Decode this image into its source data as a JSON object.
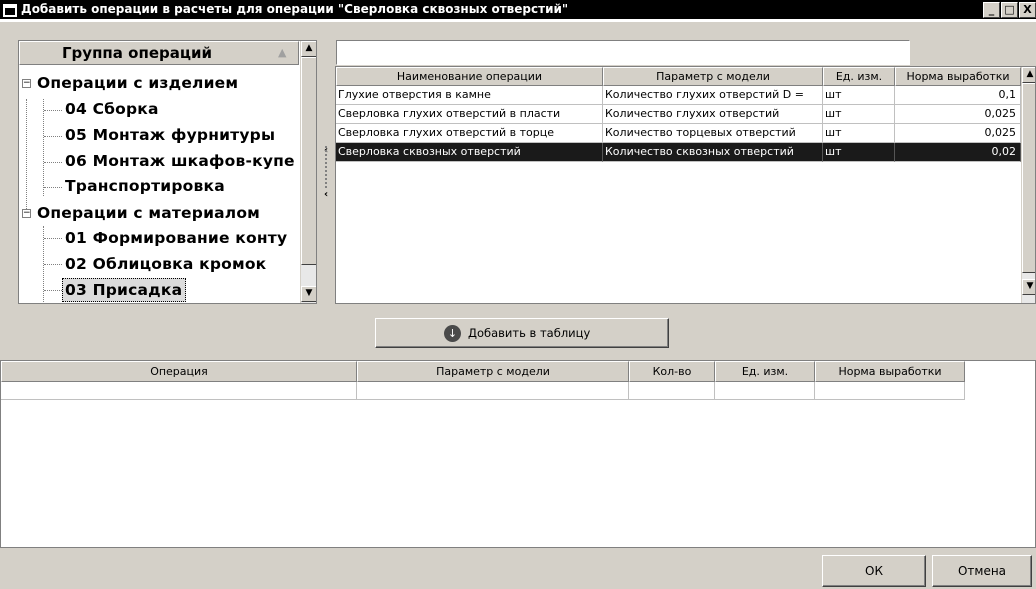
{
  "window": {
    "title": "Добавить операции в расчеты для операции \"Сверловка сквозных отверстий\"",
    "minimize": "_",
    "maximize": "□",
    "close": "X"
  },
  "tree": {
    "header": "Группа операций",
    "nodes": {
      "products": "Операции с изделием",
      "assembly": "04 Сборка",
      "fittings": "05 Монтаж фурнитуры",
      "wardrobes": "06 Монтаж шкафов-купе",
      "transport": "Транспортировка",
      "materials": "Операции с материалом",
      "contour": "01 Формирование конту",
      "edging": "02 Облицовка кромок",
      "drilling": "03 Присадка"
    }
  },
  "search": {
    "value": ""
  },
  "ops_table": {
    "columns": [
      "Наименование операции",
      "Параметр с модели",
      "Ед. изм.",
      "Норма выработки"
    ],
    "rows": [
      [
        "Глухие отверстия в камне",
        "Количество глухих отверстий D =",
        "шт",
        "0,1"
      ],
      [
        "Сверловка глухих отверстий в пласти",
        "Количество глухих отверстий",
        "шт",
        "0,025"
      ],
      [
        "Сверловка глухих отверстий в торце",
        "Количество торцевых отверстий",
        "шт",
        "0,025"
      ],
      [
        "Сверловка сквозных отверстий",
        "Количество сквозных отверстий",
        "шт",
        "0,02"
      ]
    ],
    "selected_row": 3
  },
  "add_button": {
    "label": "Добавить в таблицу"
  },
  "result_table": {
    "columns": [
      "Операция",
      "Параметр с модели",
      "Кол-во",
      "Ед. изм.",
      "Норма выработки"
    ]
  },
  "buttons": {
    "ok": "ОК",
    "cancel": "Отмена"
  }
}
